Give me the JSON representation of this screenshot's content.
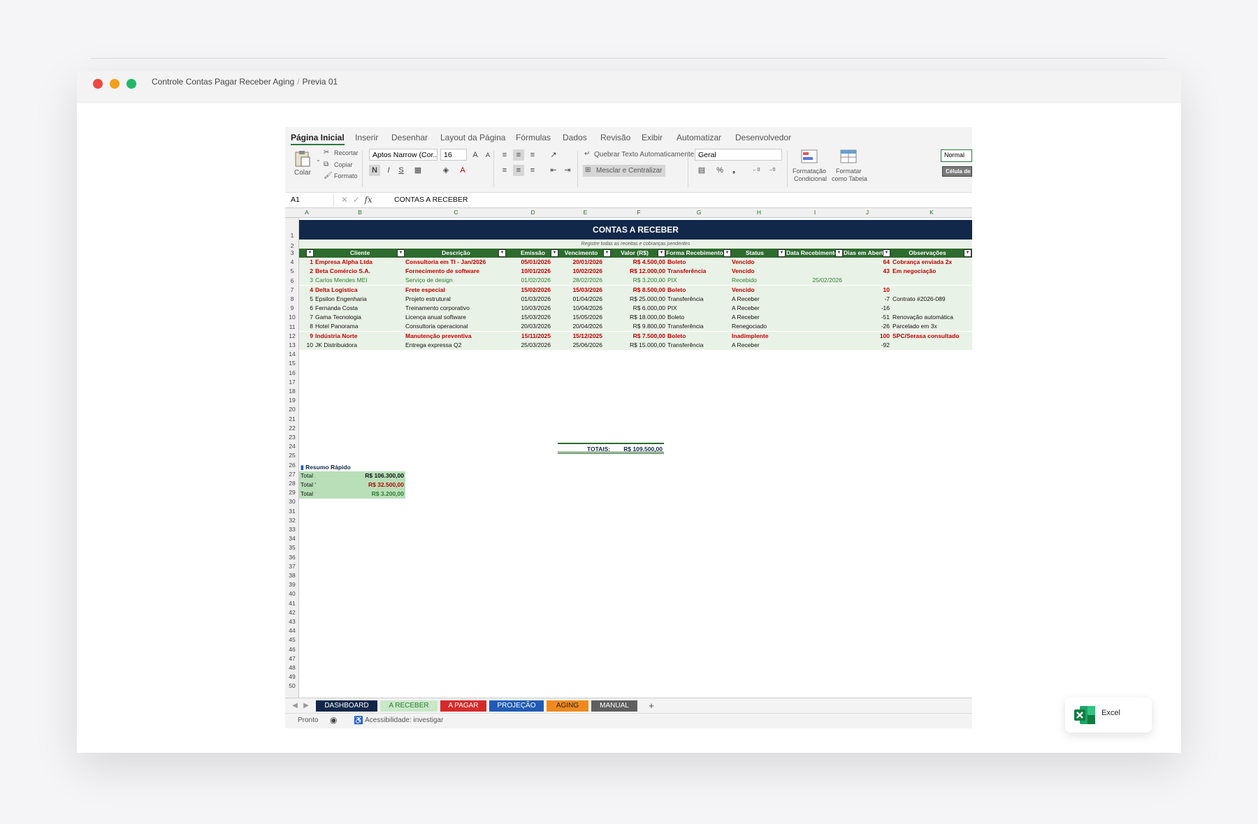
{
  "window": {
    "path": [
      "Controle Contas Pagar Receber Aging",
      "Previa 01"
    ]
  },
  "ribbon_tabs": [
    "Página Inicial",
    "Inserir",
    "Desenhar",
    "Layout da Página",
    "Fórmulas",
    "Dados",
    "Revisão",
    "Exibir",
    "Automatizar",
    "Desenvolvedor"
  ],
  "ribbon": {
    "paste": "Colar",
    "cut": "Recortar",
    "copy": "Copiar",
    "format_painter": "Formato",
    "font_name": "Aptos Narrow (Cor...",
    "font_size": "16",
    "bold": "N",
    "italic": "I",
    "underline": "S",
    "wrap_text": "Quebrar Texto Automaticamente",
    "merge": "Mesclar e Centralizar",
    "number_format": "Geral",
    "percent": "%",
    "thousands": "000",
    "cond_format": [
      "Formatação",
      "Condicional"
    ],
    "format_table": [
      "Formatar",
      "como Tabela"
    ],
    "style_normal": "Normal",
    "style_cell": "Célula de V"
  },
  "formula_bar": {
    "cell_ref": "A1",
    "fx": "fx",
    "content": "CONTAS A RECEBER"
  },
  "columns": [
    "A",
    "B",
    "C",
    "D",
    "E",
    "F",
    "G",
    "H",
    "I",
    "J",
    "K"
  ],
  "sheet": {
    "title": "CONTAS A RECEBER",
    "subtitle": "Registre todas as receitas e cobranças pendentes",
    "headers": [
      "Cliente",
      "Descrição",
      "Emissão",
      "Vencimento",
      "Valor (R$)",
      "Forma Recebimento",
      "Status",
      "Data Recebimento",
      "Dias em Aberto",
      "Observações"
    ],
    "rows": [
      {
        "n": "1",
        "cliente": "Empresa Alpha Ltda",
        "desc": "Consultoria em TI - Jan/2026",
        "emissao": "05/01/2026",
        "venc": "20/01/2026",
        "valor": "R$ 4.500,00",
        "forma": "Boleto",
        "status": "Vencido",
        "data_rec": "",
        "dias": "64",
        "obs": "Cobrança enviada 2x",
        "style": "venc"
      },
      {
        "n": "2",
        "cliente": "Beta Comércio S.A.",
        "desc": "Fornecimento de software",
        "emissao": "10/01/2026",
        "venc": "10/02/2026",
        "valor": "R$ 12.000,00",
        "forma": "Transferência",
        "status": "Vencido",
        "data_rec": "",
        "dias": "43",
        "obs": "Em negociação",
        "style": "venc"
      },
      {
        "n": "3",
        "cliente": "Carlos Mendes MEI",
        "desc": "Serviço de design",
        "emissao": "01/02/2026",
        "venc": "28/02/2026",
        "valor": "R$ 3.200,00",
        "forma": "PIX",
        "status": "Recebido",
        "data_rec": "25/02/2026",
        "dias": "",
        "obs": "",
        "style": "receb"
      },
      {
        "n": "4",
        "cliente": "Delta Logística",
        "desc": "Frete especial",
        "emissao": "15/02/2026",
        "venc": "15/03/2026",
        "valor": "R$ 8.500,00",
        "forma": "Boleto",
        "status": "Vencido",
        "data_rec": "",
        "dias": "10",
        "obs": "",
        "style": "venc"
      },
      {
        "n": "5",
        "cliente": "Epsilon Engenharia",
        "desc": "Projeto estrutural",
        "emissao": "01/03/2026",
        "venc": "01/04/2026",
        "valor": "R$ 25.000,00",
        "forma": "Transferência",
        "status": "A Receber",
        "data_rec": "",
        "dias": "-7",
        "obs": "Contrato #2026-089",
        "style": "normal"
      },
      {
        "n": "6",
        "cliente": "Fernanda Costa",
        "desc": "Treinamento corporativo",
        "emissao": "10/03/2026",
        "venc": "10/04/2026",
        "valor": "R$ 6.000,00",
        "forma": "PIX",
        "status": "A Receber",
        "data_rec": "",
        "dias": "-16",
        "obs": "",
        "style": "normal"
      },
      {
        "n": "7",
        "cliente": "Gama Tecnologia",
        "desc": "Licença anual software",
        "emissao": "15/03/2026",
        "venc": "15/05/2026",
        "valor": "R$ 18.000,00",
        "forma": "Boleto",
        "status": "A Receber",
        "data_rec": "",
        "dias": "-51",
        "obs": "Renovação automática",
        "style": "normal"
      },
      {
        "n": "8",
        "cliente": "Hotel Panorama",
        "desc": "Consultoria operacional",
        "emissao": "20/03/2026",
        "venc": "20/04/2026",
        "valor": "R$ 9.800,00",
        "forma": "Transferência",
        "status": "Renegociado",
        "data_rec": "",
        "dias": "-26",
        "obs": "Parcelado em 3x",
        "style": "normal"
      },
      {
        "n": "9",
        "cliente": "Indústria Norte",
        "desc": "Manutenção preventiva",
        "emissao": "15/11/2025",
        "venc": "15/12/2025",
        "valor": "R$ 7.500,00",
        "forma": "Boleto",
        "status": "Inadimplente",
        "data_rec": "",
        "dias": "100",
        "obs": "SPC/Serasa consultado",
        "style": "venc"
      },
      {
        "n": "10",
        "cliente": "JK Distribuidora",
        "desc": "Entrega expressa Q2",
        "emissao": "25/03/2026",
        "venc": "25/06/2026",
        "valor": "R$ 15.000,00",
        "forma": "Transferência",
        "status": "A Receber",
        "data_rec": "",
        "dias": "-92",
        "obs": "",
        "style": "normal"
      }
    ],
    "totals_label": "TOTAIS:",
    "totals_value": "R$ 109.500,00",
    "summary_title": "Resumo Rápido",
    "summary": [
      {
        "label": "Total ",
        "value": "R$ 106.300,00",
        "color": "#111111"
      },
      {
        "label": "Total '",
        "value": "R$ 32.500,00",
        "color": "#c00000"
      },
      {
        "label": "Total ",
        "value": "R$ 3.200,00",
        "color": "#2f7d32"
      }
    ]
  },
  "sheet_tabs": [
    {
      "label": "DASHBOARD",
      "bg": "#12284a",
      "fg": "#ffffff"
    },
    {
      "label": "A RECEBER",
      "bg": "#c9e7c9",
      "fg": "#2f7d32"
    },
    {
      "label": "A PAGAR",
      "bg": "#d62a2a",
      "fg": "#ffffff"
    },
    {
      "label": "PROJEÇÃO",
      "bg": "#1f5bb5",
      "fg": "#ffffff"
    },
    {
      "label": "AGING",
      "bg": "#f08a1c",
      "fg": "#222222"
    },
    {
      "label": "MANUAL",
      "bg": "#5f5f5f",
      "fg": "#ffffff"
    }
  ],
  "add_sheet": "+",
  "status_bar": {
    "ready": "Pronto",
    "accessibility": "Acessibilidade: investigar"
  },
  "app_card": {
    "label": "Excel"
  }
}
